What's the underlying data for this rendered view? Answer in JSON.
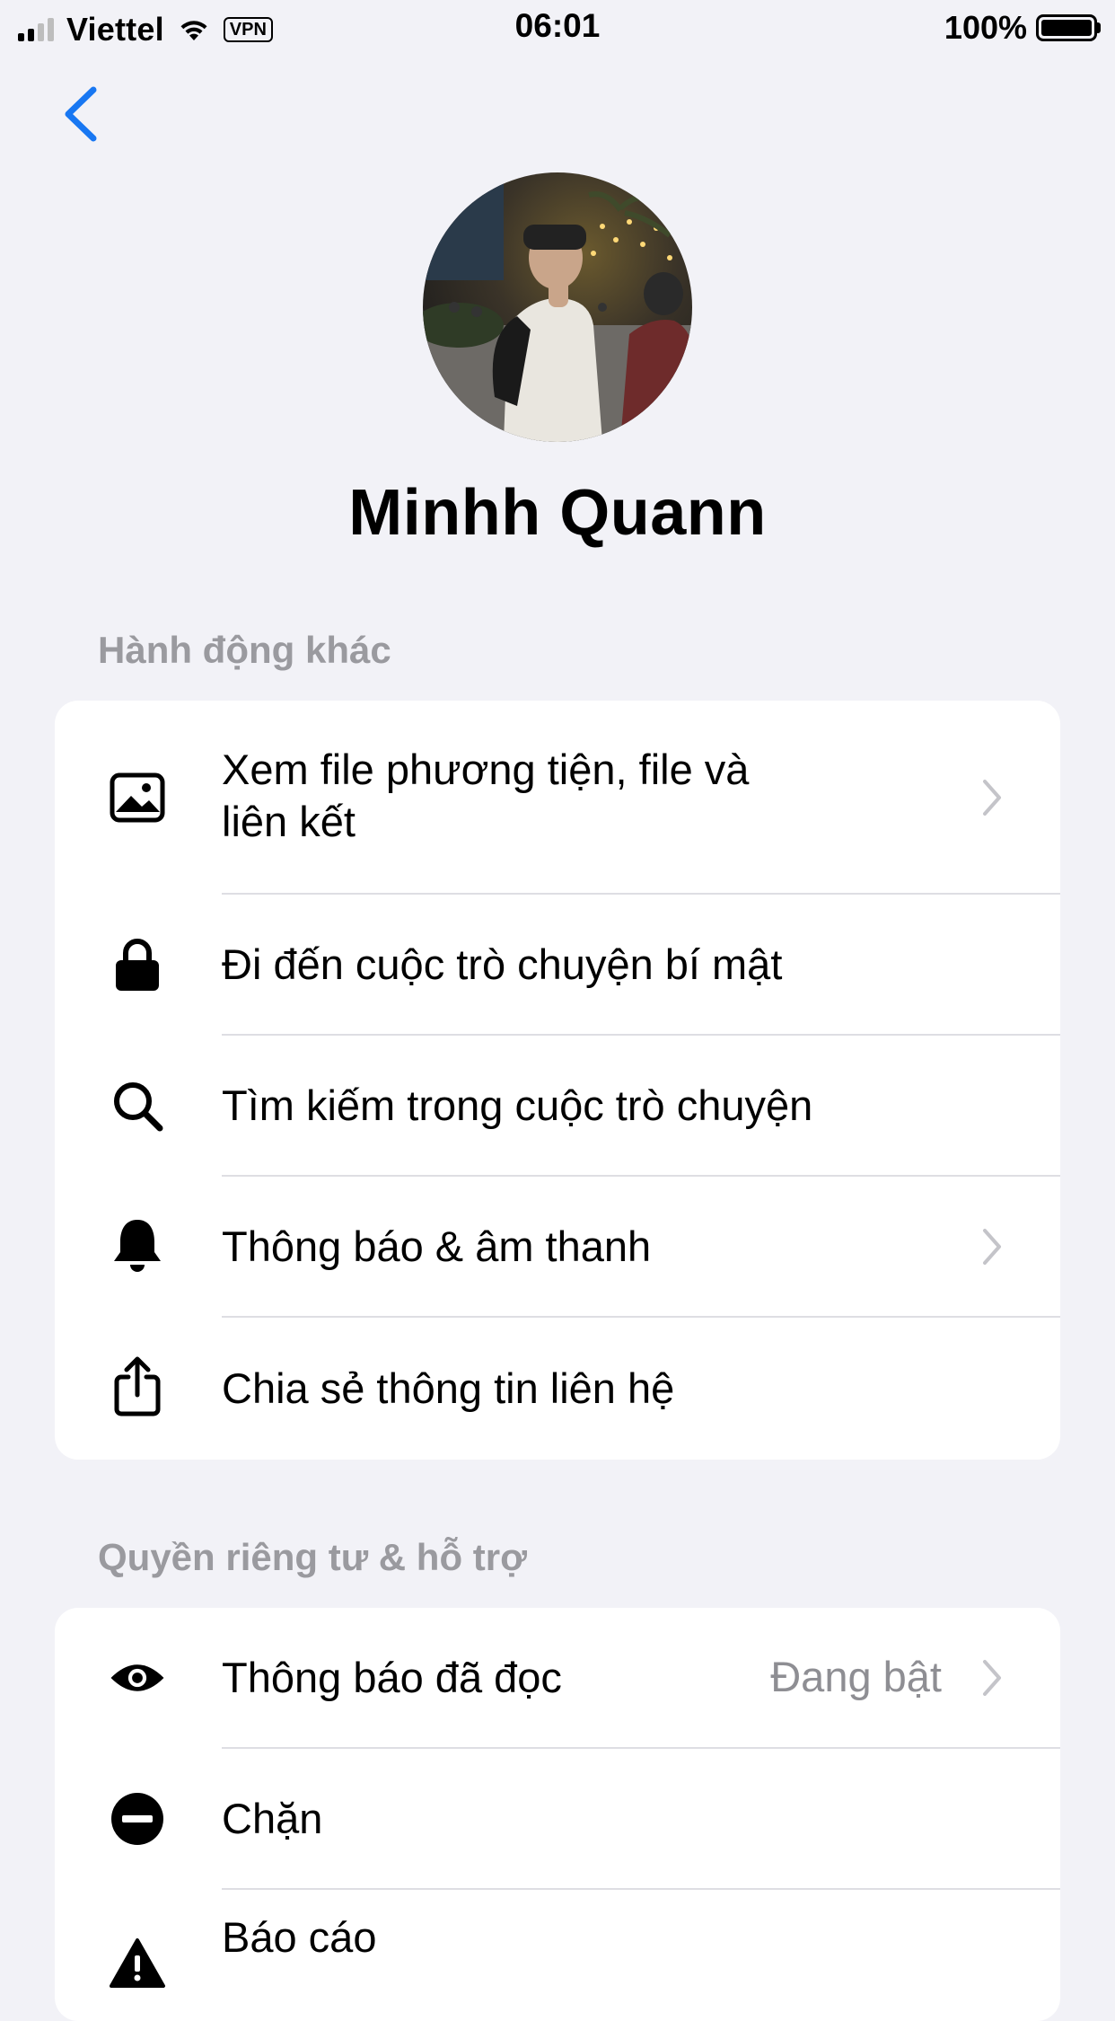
{
  "status_bar": {
    "carrier": "Viettel",
    "vpn": "VPN",
    "time": "06:01",
    "battery": "100%"
  },
  "profile": {
    "name": "Minhh Quann"
  },
  "sections": {
    "more_actions": {
      "header": "Hành động khác",
      "items": [
        {
          "label_line1": "Xem file phương tiện, file và",
          "label_line2": "liên kết",
          "icon": "photo-icon"
        },
        {
          "label": "Đi đến cuộc trò chuyện bí mật",
          "icon": "lock-icon"
        },
        {
          "label": "Tìm kiếm trong cuộc trò chuyện",
          "icon": "search-icon"
        },
        {
          "label": "Thông báo & âm thanh",
          "icon": "bell-icon"
        },
        {
          "label": "Chia sẻ thông tin liên hệ",
          "icon": "share-icon"
        }
      ]
    },
    "privacy_support": {
      "header": "Quyền riêng tư & hỗ trợ",
      "items": [
        {
          "label": "Thông báo đã đọc",
          "value": "Đang bật",
          "icon": "eye-icon"
        },
        {
          "label": "Chặn",
          "icon": "block-icon"
        },
        {
          "label": "Báo cáo",
          "icon": "warning-icon"
        }
      ]
    }
  },
  "colors": {
    "accent": "#1877f2",
    "background": "#f2f2f7",
    "secondary_text": "#9a9a9f"
  }
}
